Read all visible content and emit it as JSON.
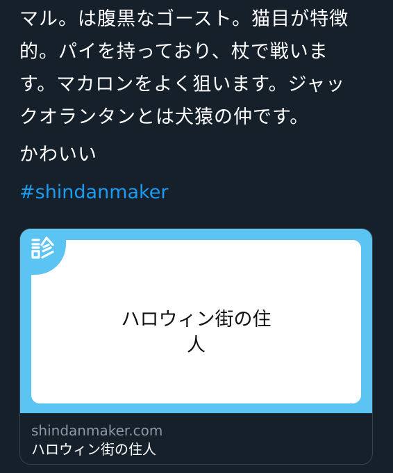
{
  "tweet": {
    "lines": [
      "マル。は腹黒なゴースト。猫目が特徴",
      "的。パイを持っており、杖で戦いま",
      "す。マカロンをよく狙います。ジャッ",
      "クオランタンとは犬猿の仲です。"
    ],
    "second_paragraph": "かわいい",
    "hashtag": "#shindanmaker"
  },
  "card": {
    "badge_glyph": "診",
    "title_line1": "ハロウィン街の住",
    "title_line2": "人",
    "domain": "shindanmaker.com",
    "footer_title": "ハロウィン街の住人"
  },
  "colors": {
    "background": "#15202b",
    "text": "#ffffff",
    "link": "#1d9bf0",
    "card_accent": "#5bc4f3",
    "card_border": "#38444d",
    "muted_text": "#8b98a5"
  }
}
